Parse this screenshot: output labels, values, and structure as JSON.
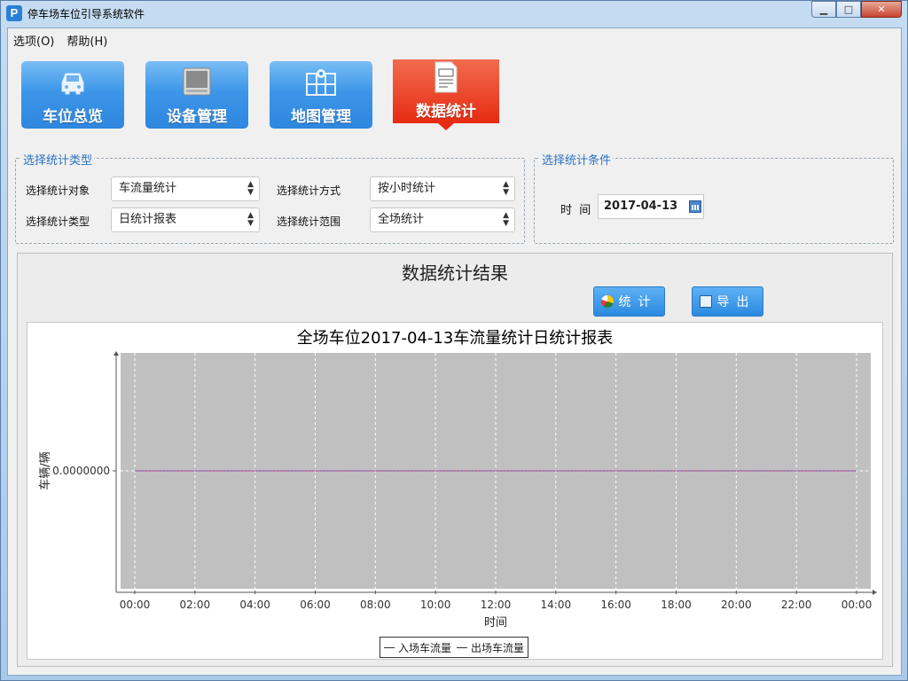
{
  "window": {
    "title": "停车场车位引导系统软件",
    "app_icon_letter": "P",
    "minimize": "▁",
    "maximize": "□",
    "close": "✕"
  },
  "menu": [
    {
      "label": "选项(O)"
    },
    {
      "label": "帮助(H)"
    }
  ],
  "nav": [
    {
      "label": "车位总览",
      "icon": "car-icon",
      "active": false
    },
    {
      "label": "设备管理",
      "icon": "monitor-icon",
      "active": false
    },
    {
      "label": "地图管理",
      "icon": "map-icon",
      "active": false
    },
    {
      "label": "数据统计",
      "icon": "report-icon",
      "active": true
    }
  ],
  "type_group": {
    "legend": "选择统计类型",
    "object_label": "选择统计对象",
    "object_value": "车流量统计",
    "method_label": "选择统计方式",
    "method_value": "按小时统计",
    "type_label": "选择统计类型",
    "type_value": "日统计报表",
    "range_label": "选择统计范围",
    "range_value": "全场统计"
  },
  "condition_group": {
    "legend": "选择统计条件",
    "time_label": "时  间",
    "date_value": "2017-04-13"
  },
  "result": {
    "title": "数据统计结果",
    "stat_button": "统计",
    "export_button": "导出"
  },
  "colors": {
    "tile_blue": "#3d96e8",
    "tile_active": "#e62b12",
    "legend_text": "#2b73c4",
    "plot_bg": "#c0c0c0",
    "series_in": "#ff3b3b",
    "series_out": "#3b5bff"
  },
  "chart_data": {
    "type": "line",
    "title": "全场车位2017-04-13车流量统计日统计报表",
    "xlabel": "时间",
    "ylabel": "车辆/辆",
    "categories": [
      "00:00",
      "02:00",
      "04:00",
      "06:00",
      "08:00",
      "10:00",
      "12:00",
      "14:00",
      "16:00",
      "18:00",
      "20:00",
      "22:00",
      "00:00"
    ],
    "y_tick_labels": [
      "0.0000000"
    ],
    "ylim": [
      -1,
      1
    ],
    "grid": true,
    "legend_position": "bottom",
    "series": [
      {
        "name": "入场车流量",
        "values": [
          0,
          0,
          0,
          0,
          0,
          0,
          0,
          0,
          0,
          0,
          0,
          0,
          0
        ],
        "color": "#ff3b3b"
      },
      {
        "name": "出场车流量",
        "values": [
          0,
          0,
          0,
          0,
          0,
          0,
          0,
          0,
          0,
          0,
          0,
          0,
          0
        ],
        "color": "#3b5bff"
      }
    ]
  }
}
